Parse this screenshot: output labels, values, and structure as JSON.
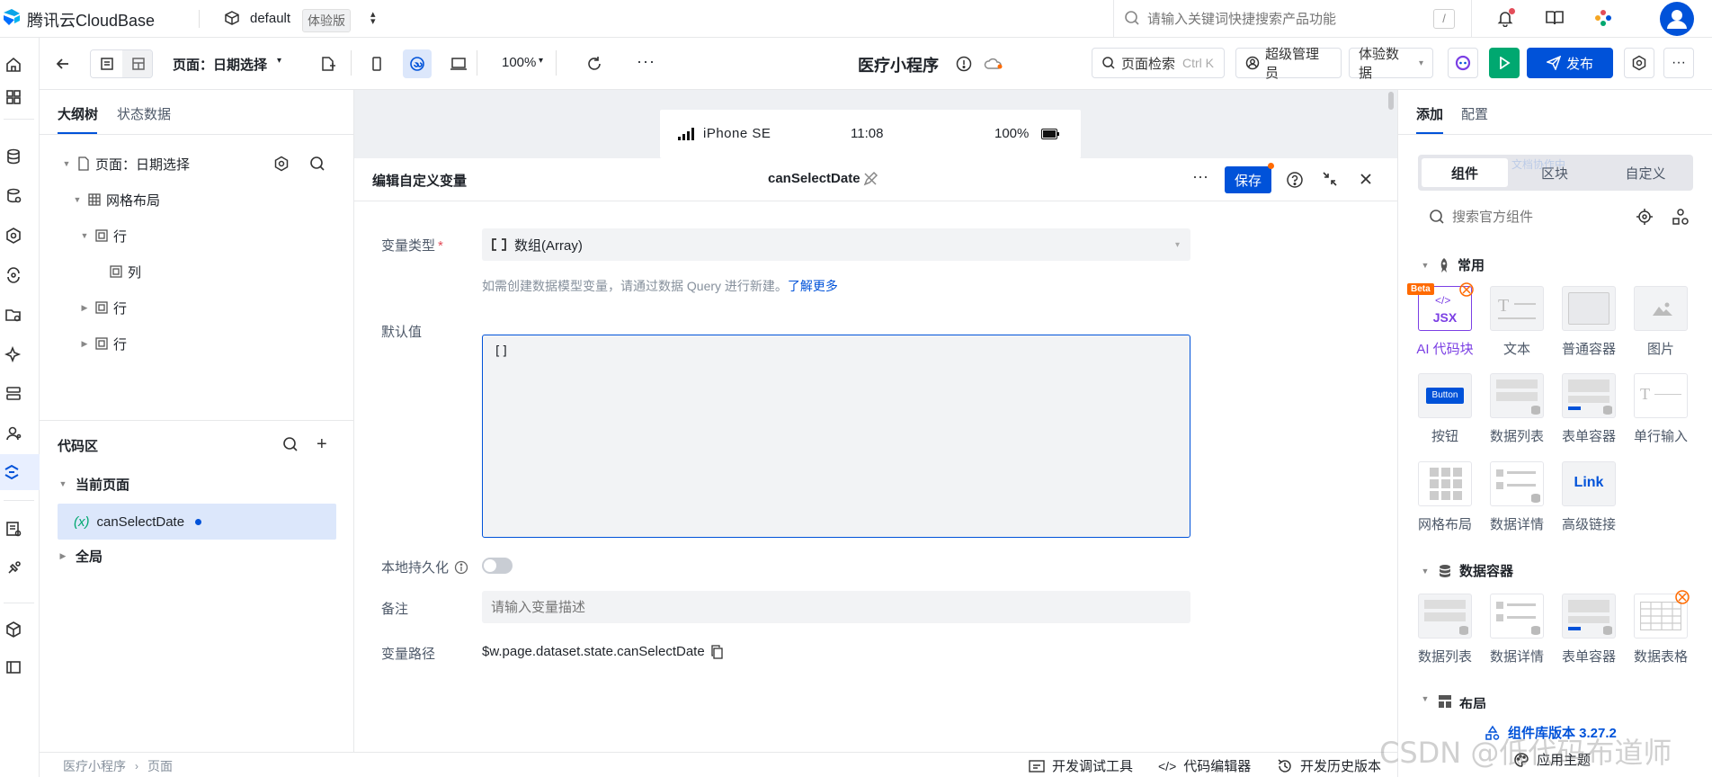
{
  "topbar": {
    "brand": "腾讯云CloudBase",
    "env_name": "default",
    "env_badge": "体验版",
    "search_placeholder": "请输入关键词快捷搜索产品功能",
    "search_shortcut": "/"
  },
  "toolbar": {
    "page_selector": "页面：日期选择",
    "zoom": "100%",
    "app_title": "医疗小程序",
    "page_search": "页面检索",
    "page_search_shortcut": "Ctrl K",
    "admin_label": "超级管理员",
    "data_mode": "体验数据",
    "publish_label": "发布"
  },
  "left_panel": {
    "tabs": [
      "大纲树",
      "状态数据"
    ],
    "tree": {
      "page": "页面：日期选择",
      "grid": "网格布局",
      "row1": "行",
      "col": "列",
      "row2": "行",
      "row3": "行"
    },
    "code_area": {
      "title": "代码区",
      "current_page": "当前页面",
      "variable": "canSelectDate",
      "global": "全局"
    }
  },
  "phone": {
    "carrier": "iPhone SE",
    "time": "11:08",
    "battery": "100%"
  },
  "modal": {
    "title": "编辑自定义变量",
    "variable_name": "canSelectDate",
    "save_label": "保存",
    "var_type_label": "变量类型",
    "var_type_value": "数组(Array)",
    "hint_text": "如需创建数据模型变量，请通过数据 Query 进行新建。",
    "hint_link": "了解更多",
    "default_label": "默认值",
    "default_value": "[]",
    "persist_label": "本地持久化",
    "note_label": "备注",
    "note_placeholder": "请输入变量描述",
    "path_label": "变量路径",
    "path_value": "$w.page.dataset.state.canSelectDate"
  },
  "right_panel": {
    "tabs": [
      "添加",
      "配置"
    ],
    "segments": [
      "组件",
      "区块",
      "自定义"
    ],
    "search_placeholder": "搜索官方组件",
    "section_common": "常用",
    "section_data": "数据容器",
    "section_layout": "布局",
    "beta_badge": "Beta",
    "jsx_text": "JSX",
    "button_text": "Button",
    "link_text": "Link",
    "common_items": [
      "AI 代码块",
      "文本",
      "普通容器",
      "图片",
      "按钮",
      "数据列表",
      "表单容器",
      "单行输入",
      "网格布局",
      "数据详情",
      "高级链接"
    ],
    "data_items": [
      "数据列表",
      "数据详情",
      "表单容器",
      "数据表格"
    ],
    "lib_version": "组件库版本 3.27.2",
    "theme": "应用主题",
    "ghost_text": "文档协作中"
  },
  "statusbar": {
    "breadcrumb": [
      "医疗小程序",
      "页面"
    ],
    "debug_tool": "开发调试工具",
    "code_editor": "代码编辑器",
    "history": "开发历史版本"
  },
  "watermark": "CSDN @低代码布道师",
  "colors": {
    "primary": "#0052d9",
    "run_green": "#00a870",
    "accent_purple": "#7b3fe4",
    "selection_bg": "#dce7fb"
  }
}
